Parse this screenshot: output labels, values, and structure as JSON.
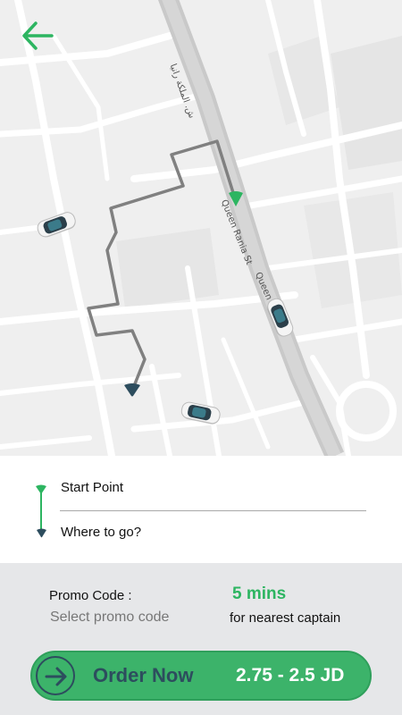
{
  "map": {
    "street_label_arabic": "ش. الملكة رانيا",
    "street_label_queen_rania": "Queen Rania St",
    "street_label_queen": "Queen",
    "icons": {
      "back": "arrow-left-icon",
      "car": "car-icon",
      "start": "green-pin-icon",
      "destination": "blue-pin-icon"
    }
  },
  "route": {
    "start_label": "Start Point",
    "destination_label": "Where to go?"
  },
  "promo": {
    "label": "Promo Code :",
    "placeholder": "Select promo code"
  },
  "eta": {
    "value": "5 mins",
    "caption": "for nearest captain"
  },
  "order": {
    "label": "Order Now",
    "price": "2.75 - 2.5 JD",
    "icon": "arrow-right-icon"
  },
  "colors": {
    "accent_green": "#2db561",
    "dark_blue": "#2d4d5e",
    "panel_gray": "#e6e7e9"
  }
}
